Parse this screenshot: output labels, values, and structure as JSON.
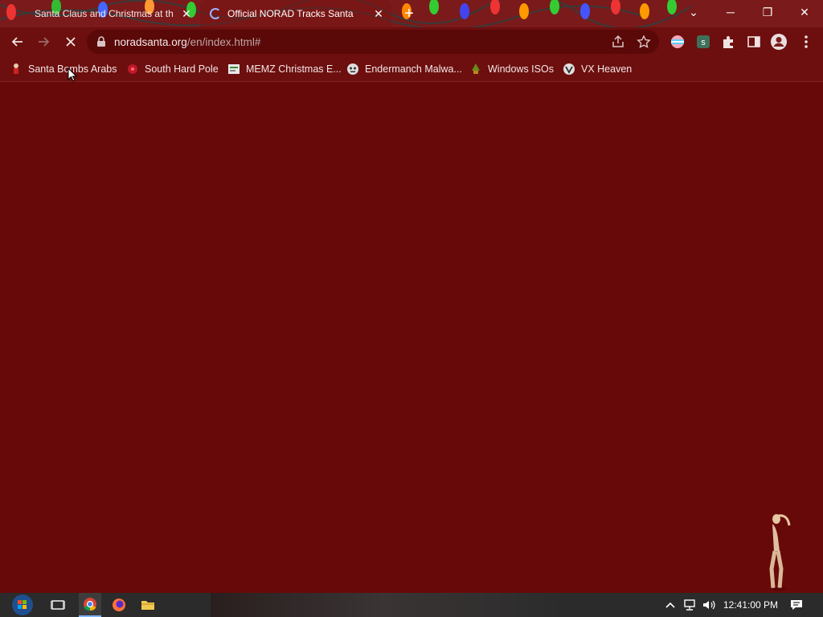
{
  "browser": {
    "tabs": [
      {
        "title": "Santa Claus and Christmas at the North Pole",
        "close": "✕"
      },
      {
        "title": "Official NORAD Tracks Santa",
        "close": "✕"
      }
    ],
    "new_tab": "+",
    "window_controls": {
      "chevron": "⌄",
      "minimize": "─",
      "restore": "❐",
      "close": "✕"
    },
    "address": {
      "host": "noradsanta.org",
      "path": "/en/index.html#"
    },
    "bookmarks": [
      {
        "label": "Santa Bombs Arabs",
        "icon": "santa-figure-icon"
      },
      {
        "label": "South Hard Pole",
        "icon": "red-flower-icon"
      },
      {
        "label": "MEMZ Christmas E...",
        "icon": "memz-icon"
      },
      {
        "label": "Endermanch Malwa...",
        "icon": "robot-head-icon"
      },
      {
        "label": "Windows ISOs",
        "icon": "tree-icon"
      },
      {
        "label": "VX Heaven",
        "icon": "vx-icon"
      }
    ]
  },
  "taskbar": {
    "clock": "12:41:00 PM"
  },
  "colors": {
    "page_bg": "#690a0a",
    "toolbar_bg": "#6d0f0f",
    "taskbar_bg": "#2b2b2b"
  }
}
